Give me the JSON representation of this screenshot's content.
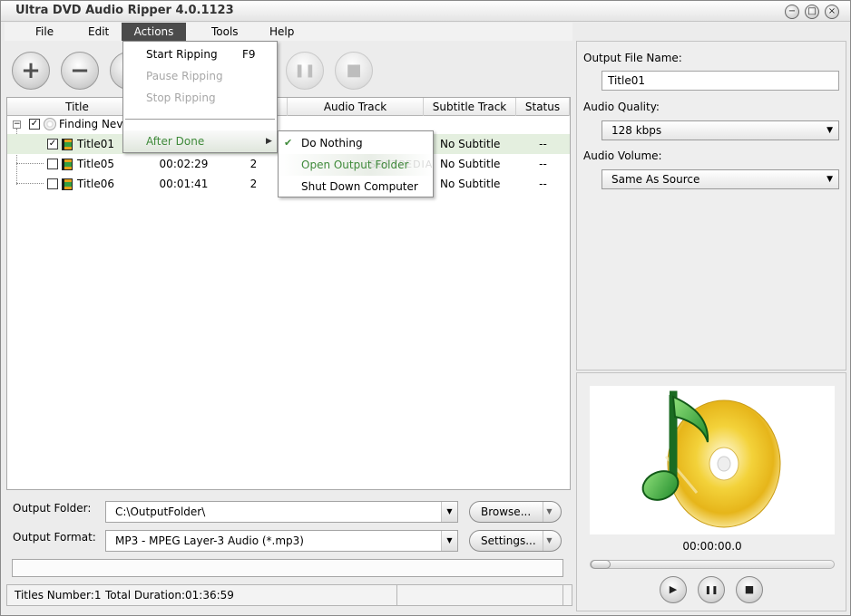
{
  "app": {
    "title": "Ultra DVD Audio Ripper 4.0.1123",
    "window_controls": [
      "minimize-icon",
      "maximize-icon",
      "close-icon"
    ]
  },
  "menubar": {
    "items": [
      "File",
      "Edit",
      "Actions",
      "Tools",
      "Help"
    ],
    "active": "Actions"
  },
  "toolbar": {
    "buttons": [
      {
        "name": "add-icon",
        "glyph": "+",
        "enabled": true
      },
      {
        "name": "remove-icon",
        "glyph": "−",
        "enabled": true
      },
      {
        "name": "play-icon",
        "glyph": "",
        "enabled": true
      },
      {
        "name": "pause-icon",
        "glyph": "❚❚",
        "enabled": false
      },
      {
        "name": "stop-icon",
        "glyph": "■",
        "enabled": false
      }
    ]
  },
  "actions_menu": {
    "items": [
      {
        "label": "Start Ripping",
        "shortcut": "F9",
        "enabled": true
      },
      {
        "label": "Pause Ripping",
        "shortcut": "",
        "enabled": false
      },
      {
        "label": "Stop Ripping",
        "shortcut": "",
        "enabled": false
      },
      {
        "label": "After Done",
        "shortcut": "",
        "enabled": true,
        "submenu": true
      }
    ]
  },
  "after_done_submenu": {
    "items": [
      {
        "label": "Do Nothing",
        "checked": true
      },
      {
        "label": "Open Output Folder",
        "checked": false
      },
      {
        "label": "Shut Down Computer",
        "checked": false
      }
    ],
    "watermark": "SOFTPEDIA"
  },
  "table": {
    "columns": [
      "Title",
      "",
      "",
      "Audio Track",
      "Subtitle Track",
      "Status"
    ],
    "root": {
      "label": "Finding Neve",
      "checked": true
    },
    "rows": [
      {
        "title": "Title01",
        "checked": true,
        "duration": "",
        "chapters": "",
        "audio": "",
        "subtitle": "No Subtitle",
        "status": "--"
      },
      {
        "title": "Title05",
        "checked": false,
        "duration": "00:02:29",
        "chapters": "2",
        "audio": "",
        "subtitle": "No Subtitle",
        "status": "--"
      },
      {
        "title": "Title06",
        "checked": false,
        "duration": "00:01:41",
        "chapters": "2",
        "audio": "",
        "subtitle": "No Subtitle",
        "status": "--"
      }
    ]
  },
  "output": {
    "folder_label": "Output Folder:",
    "folder_value": "C:\\OutputFolder\\",
    "browse_label": "Browse...",
    "format_label": "Output Format:",
    "format_value": "MP3 - MPEG Layer-3 Audio (*.mp3)",
    "settings_label": "Settings...",
    "progress": 0
  },
  "statusbar": {
    "titles": "Titles Number:1",
    "duration": "Total Duration:01:36:59",
    "extra": ""
  },
  "settings": {
    "output_file_name_label": "Output File Name:",
    "output_file_name": "Title01",
    "audio_quality_label": "Audio Quality:",
    "audio_quality": "128 kbps",
    "audio_volume_label": "Audio Volume:",
    "audio_volume": "Same As Source"
  },
  "preview": {
    "time": "00:00:00.0",
    "seek_fraction": 0
  },
  "colors": {
    "accent_green": "#3f8a3a",
    "menu_active": "#4b4b4b",
    "selected_row": "#e4efdf"
  }
}
